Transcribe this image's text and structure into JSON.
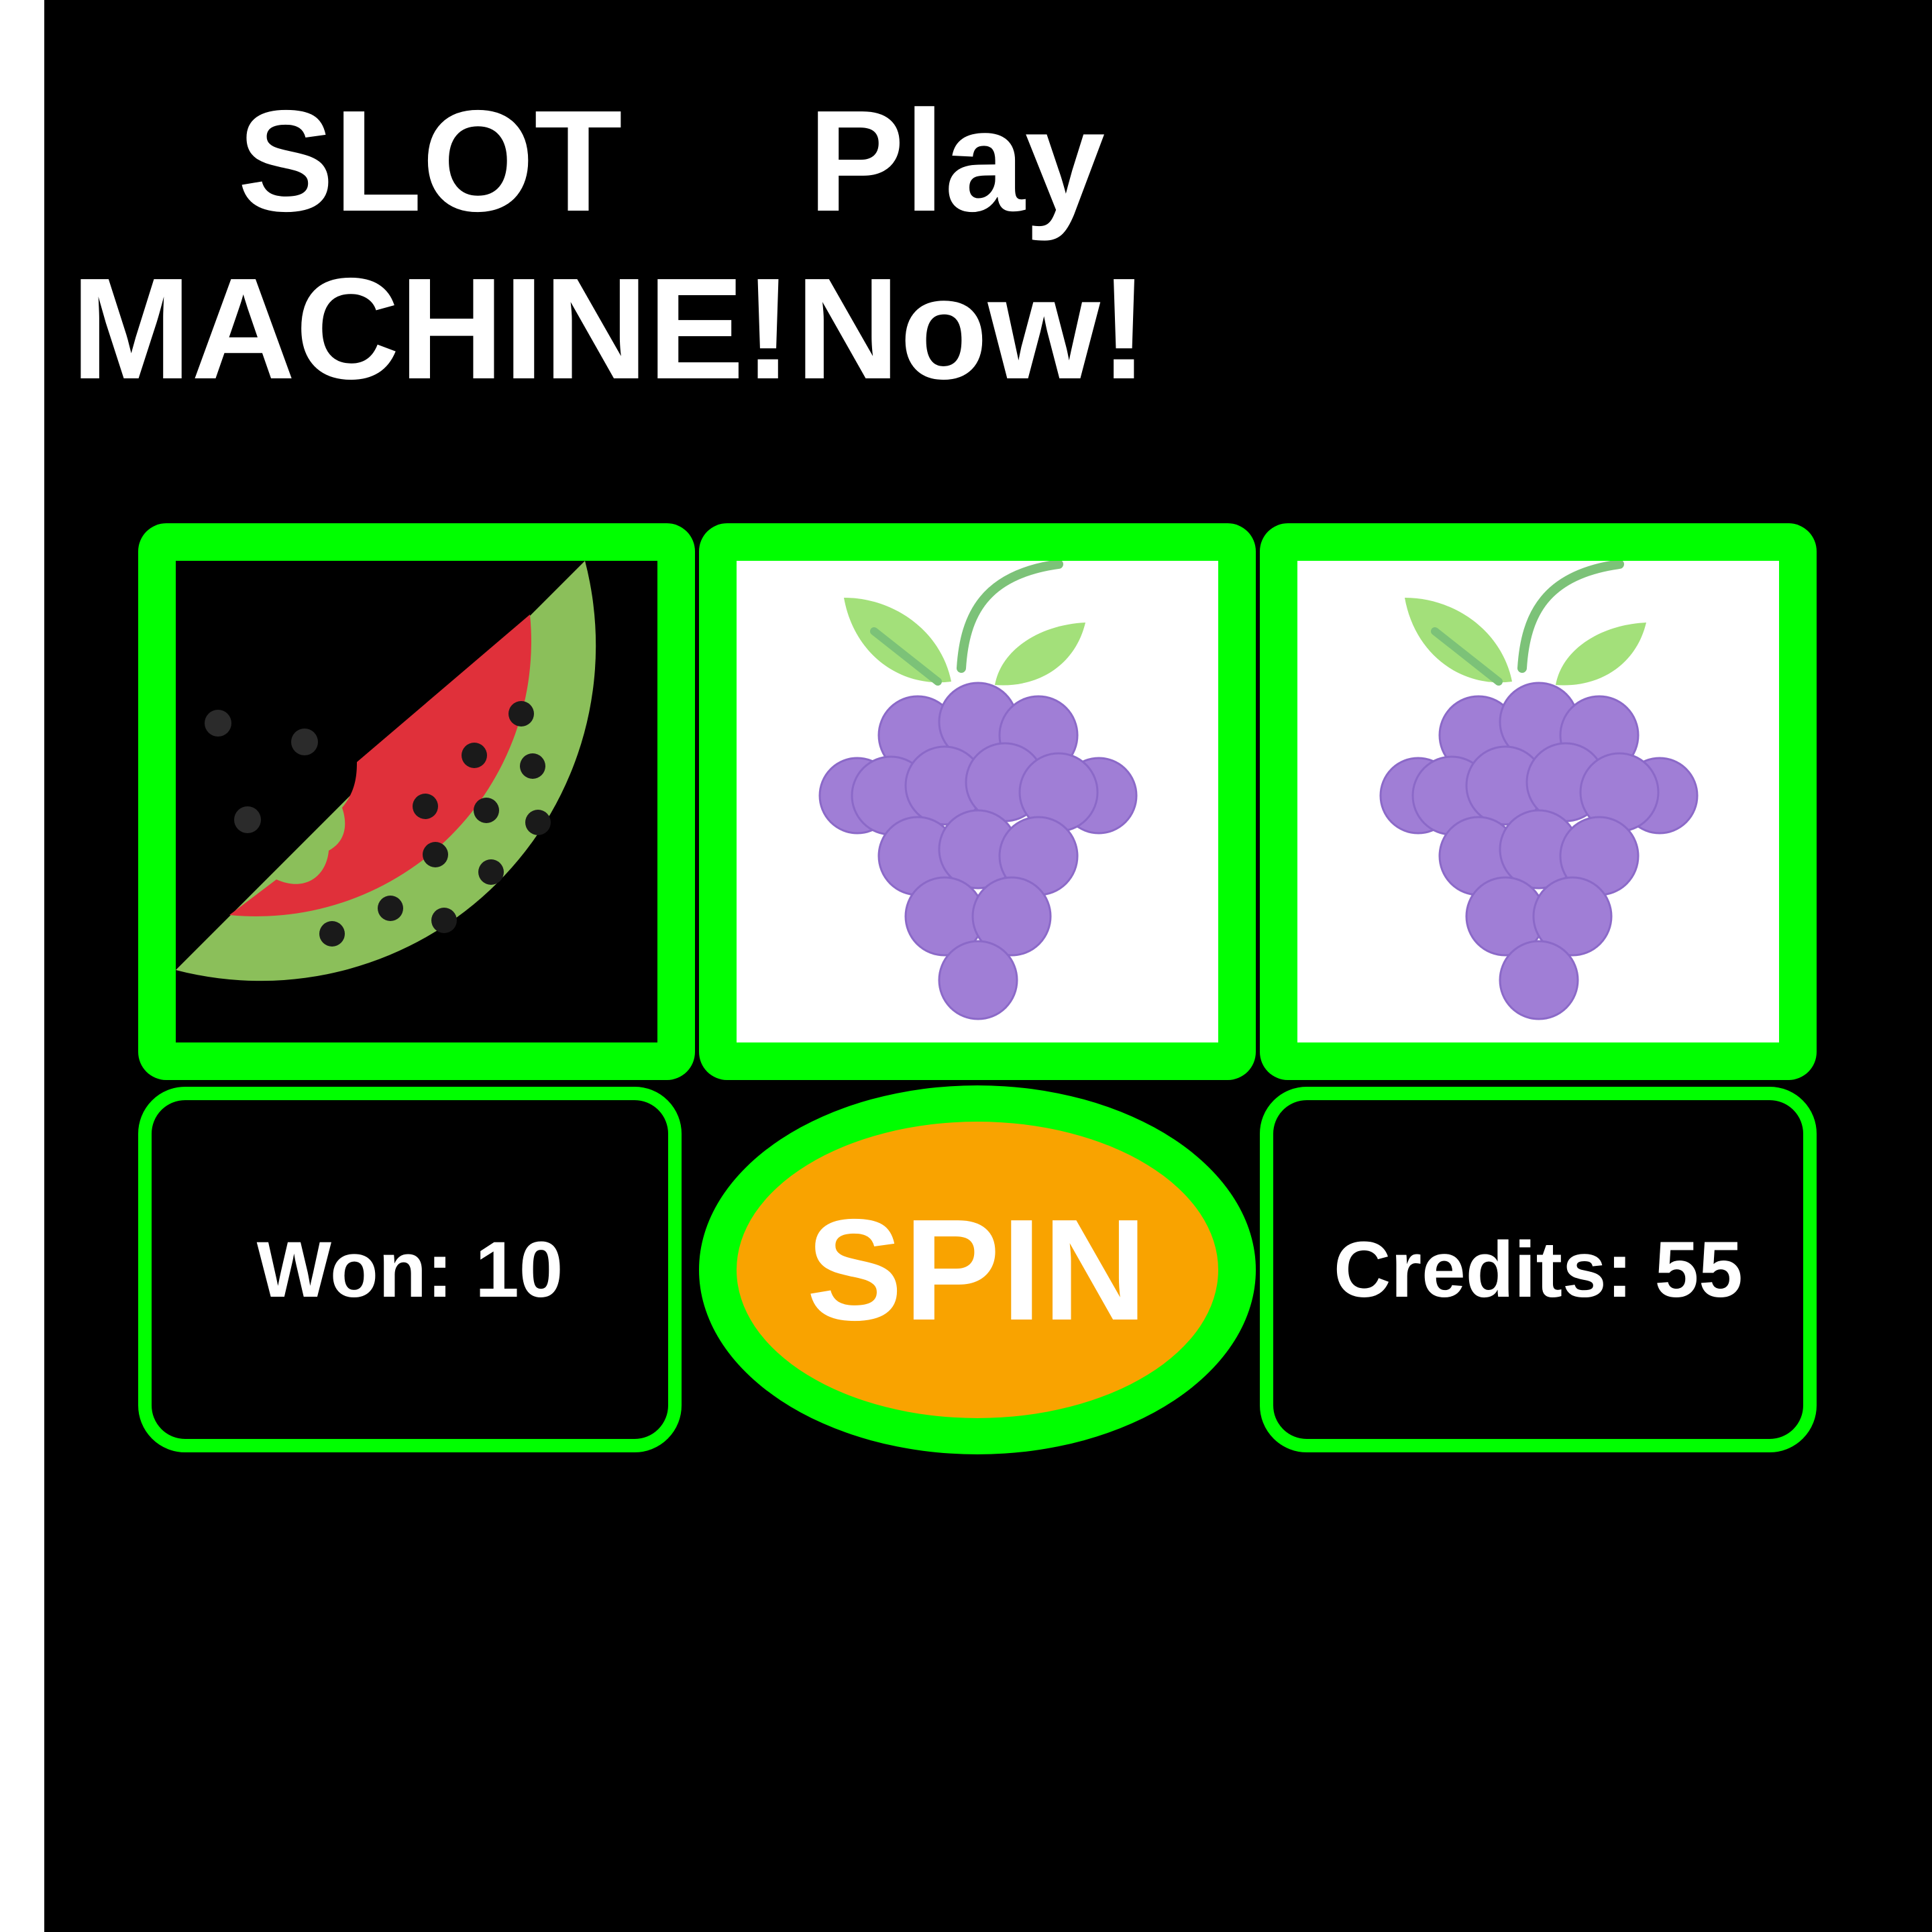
{
  "header": {
    "title_line1": "SLOT",
    "title_line2": "MACHINE!",
    "tagline_line1": "Play",
    "tagline_line2": "Now!"
  },
  "reels": [
    {
      "symbol": "watermelon",
      "background": "#000000"
    },
    {
      "symbol": "grapes",
      "background": "#ffffff"
    },
    {
      "symbol": "grapes",
      "background": "#ffffff"
    }
  ],
  "stats": {
    "won_label": "Won: 10",
    "credits_label": "Credits: 55"
  },
  "controls": {
    "spin_label": "SPIN"
  },
  "colors": {
    "background": "#000000",
    "frame": "#00ff00",
    "spin_button": "#f9a300",
    "text": "#ffffff"
  }
}
